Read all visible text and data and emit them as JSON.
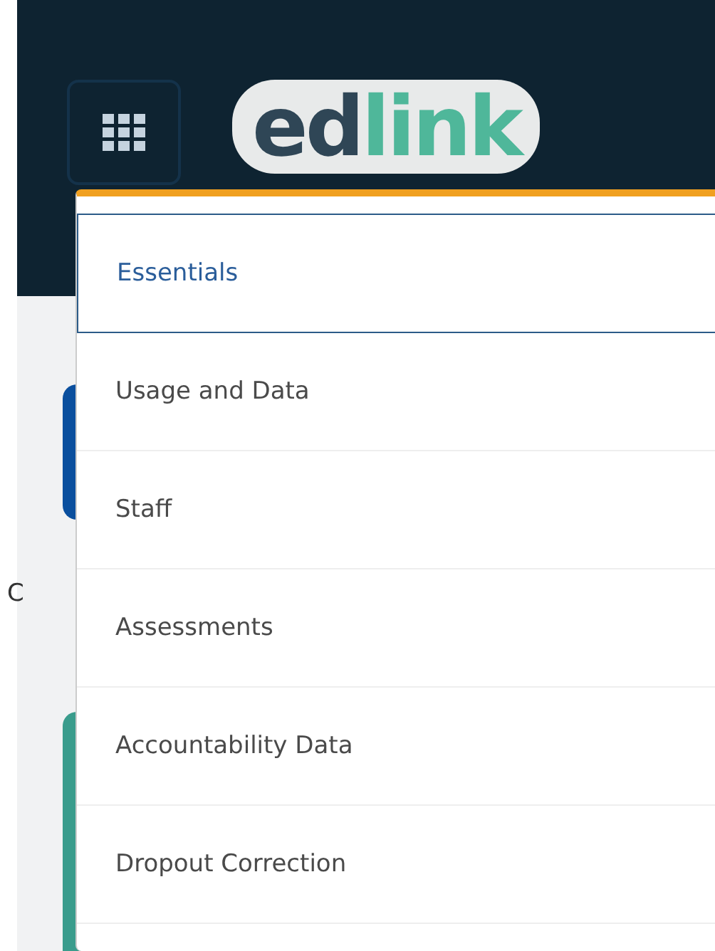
{
  "header": {
    "logo": {
      "part_1": "ed",
      "part_2": "link"
    }
  },
  "background": {
    "fragment": "C"
  },
  "menu": {
    "items": [
      {
        "label": "Essentials",
        "selected": true
      },
      {
        "label": "Usage and Data",
        "selected": false
      },
      {
        "label": "Staff",
        "selected": false
      },
      {
        "label": "Assessments",
        "selected": false
      },
      {
        "label": "Accountability Data",
        "selected": false
      },
      {
        "label": "Dropout Correction",
        "selected": false
      }
    ]
  }
}
